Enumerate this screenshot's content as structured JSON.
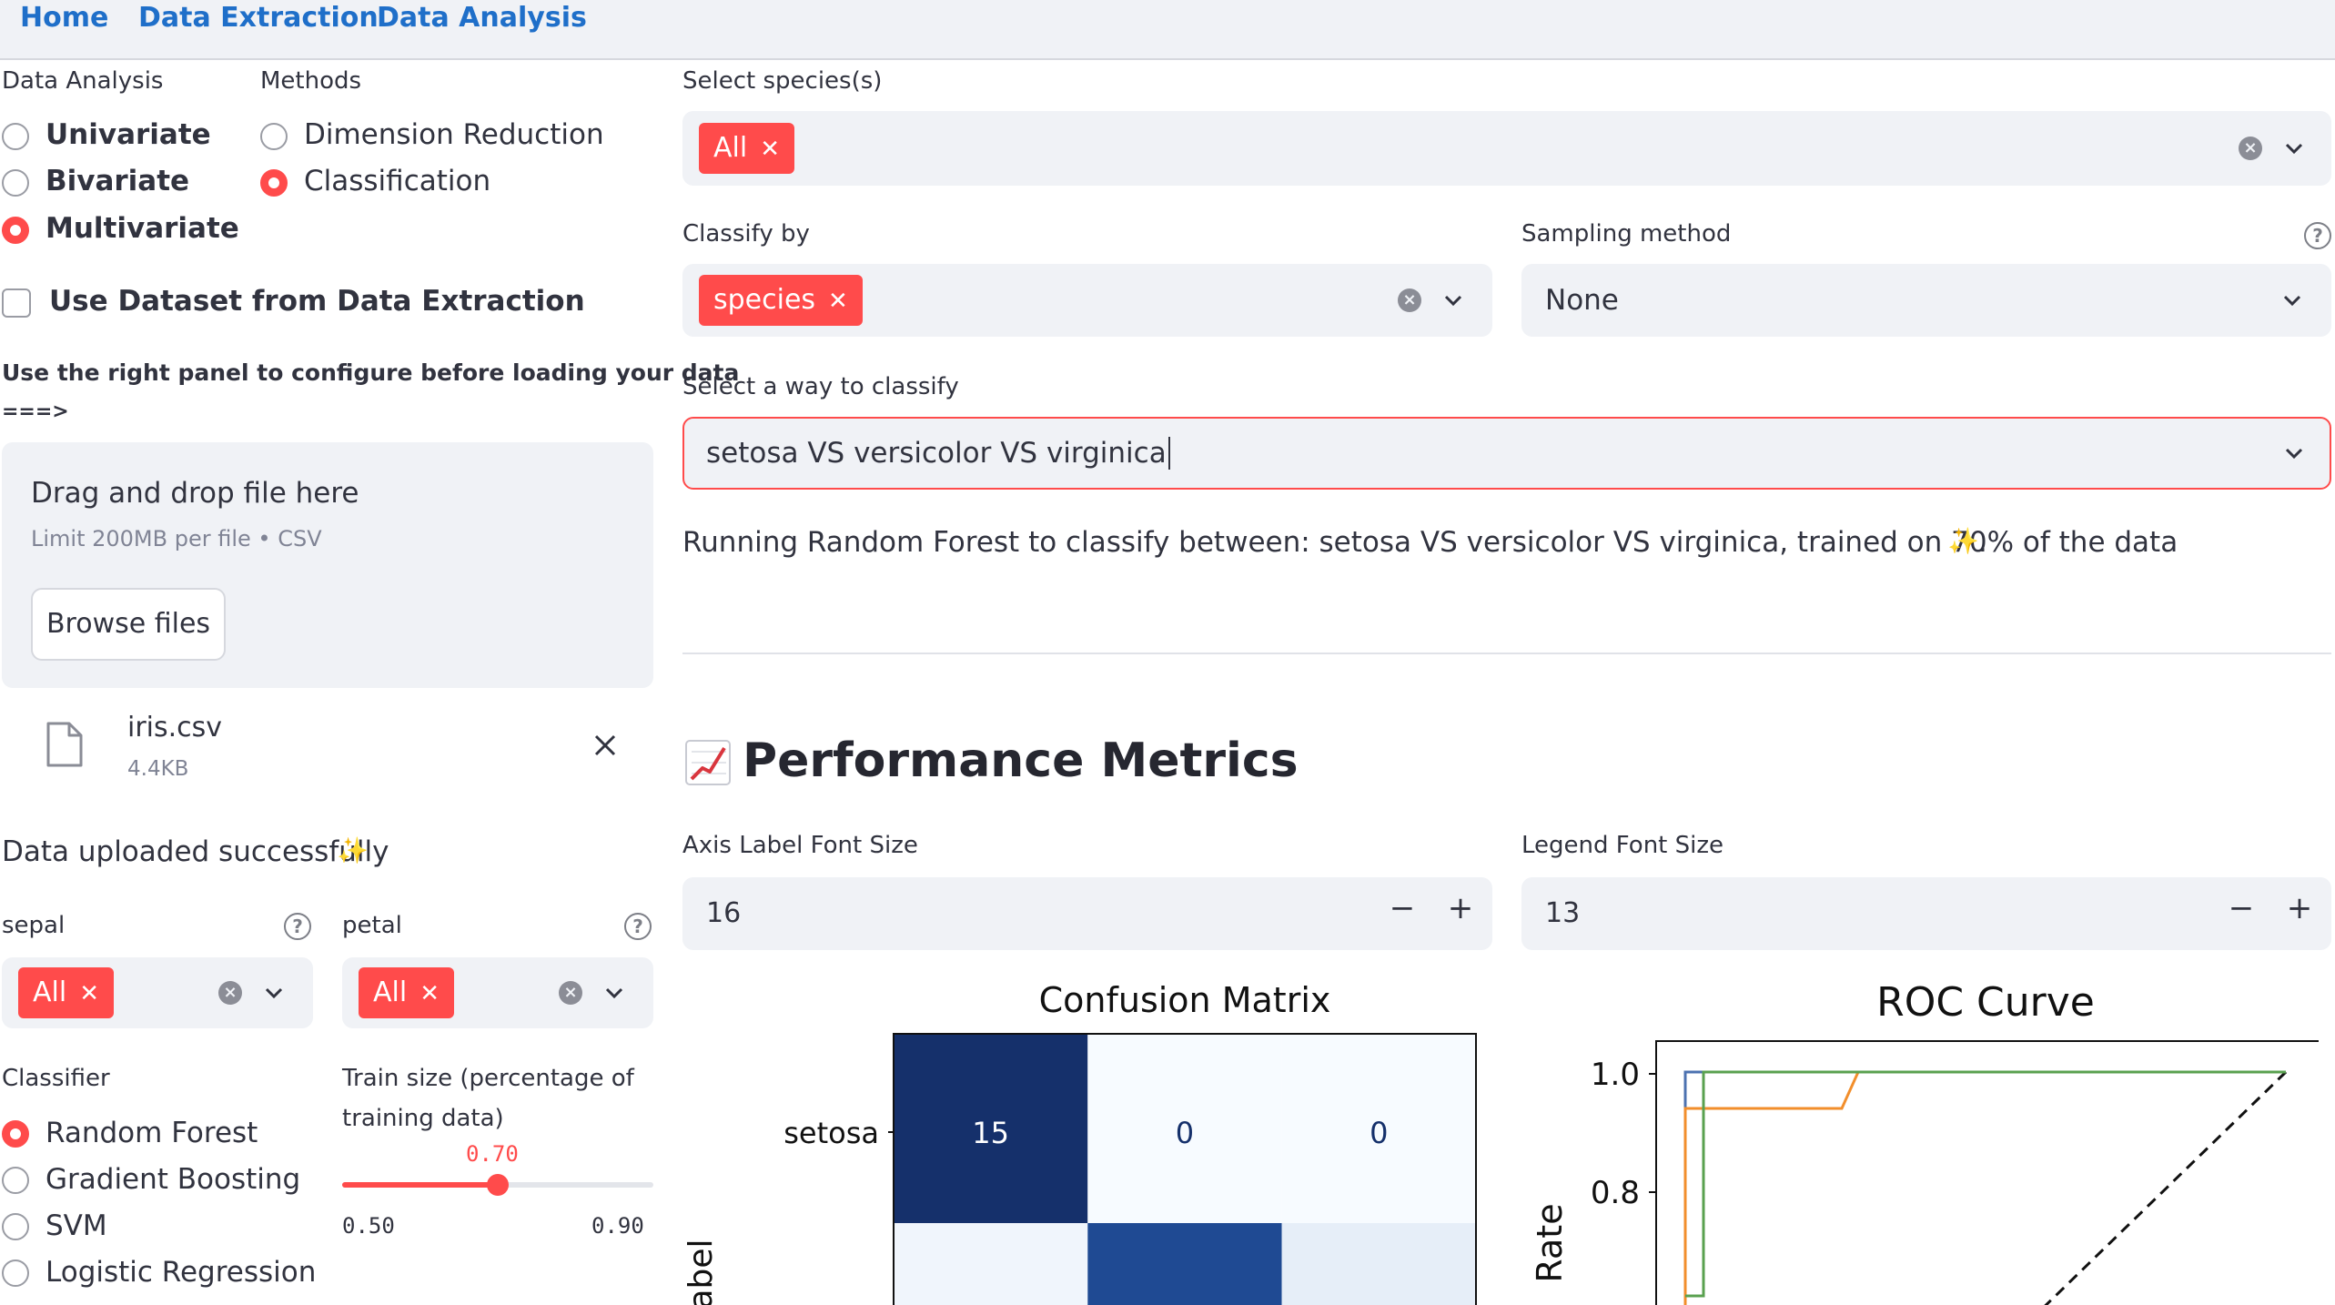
{
  "nav": {
    "links": [
      "Home",
      "Data Extraction",
      "Data Analysis"
    ]
  },
  "sidebar": {
    "analysis_title": "Data Analysis",
    "analysis_options": [
      "Univariate",
      "Bivariate",
      "Multivariate"
    ],
    "analysis_selected": "Multivariate",
    "methods_title": "Methods",
    "methods_options": [
      "Dimension Reduction",
      "Classification"
    ],
    "methods_selected": "Classification",
    "use_dataset_label": "Use Dataset from Data Extraction",
    "instruction_line1": "Use the right panel to configure before loading your data",
    "instruction_line2": "===>",
    "uploader": {
      "title": "Drag and drop file here",
      "limit": "Limit 200MB per file • CSV",
      "browse_label": "Browse files"
    },
    "file": {
      "name": "iris.csv",
      "size": "4.4KB"
    },
    "success_text": "Data uploaded successfully",
    "sepal": {
      "label": "sepal",
      "chip": "All"
    },
    "petal": {
      "label": "petal",
      "chip": "All"
    },
    "classifier": {
      "title": "Classifier",
      "options": [
        "Random Forest",
        "Gradient Boosting",
        "SVM",
        "Logistic Regression"
      ],
      "selected": "Random Forest"
    },
    "train_size": {
      "label_line1": "Train size (percentage of",
      "label_line2": "training data)",
      "value": "0.70",
      "min": "0.50",
      "max": "0.90"
    }
  },
  "main": {
    "species_label": "Select species(s)",
    "species_chip": "All",
    "classify_by_label": "Classify by",
    "classify_by_chip": "species",
    "sampling_label": "Sampling method",
    "sampling_value": "None",
    "way_label": "Select a way to classify",
    "way_value": "setosa VS versicolor VS virginica",
    "running_text": "Running Random Forest to classify between: setosa VS versicolor VS virginica, trained on 70% of the data",
    "running_suffix": ".",
    "metrics_title": "Performance Metrics",
    "axis_font_label": "Axis Label Font Size",
    "axis_font_value": "16",
    "legend_font_label": "Legend Font Size",
    "legend_font_value": "13"
  },
  "colors": {
    "accent": "#ff4b4b",
    "link": "#1f6fc9",
    "field_bg": "#f0f2f6"
  },
  "chart_data": [
    {
      "type": "heatmap",
      "title": "Confusion Matrix",
      "y_tick_labels": [
        "setosa"
      ],
      "ylabel_partial": "abel",
      "visible_rows": [
        [
          15,
          0,
          0
        ]
      ]
    },
    {
      "type": "line",
      "title": "ROC Curve",
      "ylabel_partial": "Rate",
      "y_ticks": [
        "1.0",
        "0.8"
      ],
      "series_colors": [
        "#4c72b0",
        "#f28e2b",
        "#59a14f"
      ]
    }
  ]
}
